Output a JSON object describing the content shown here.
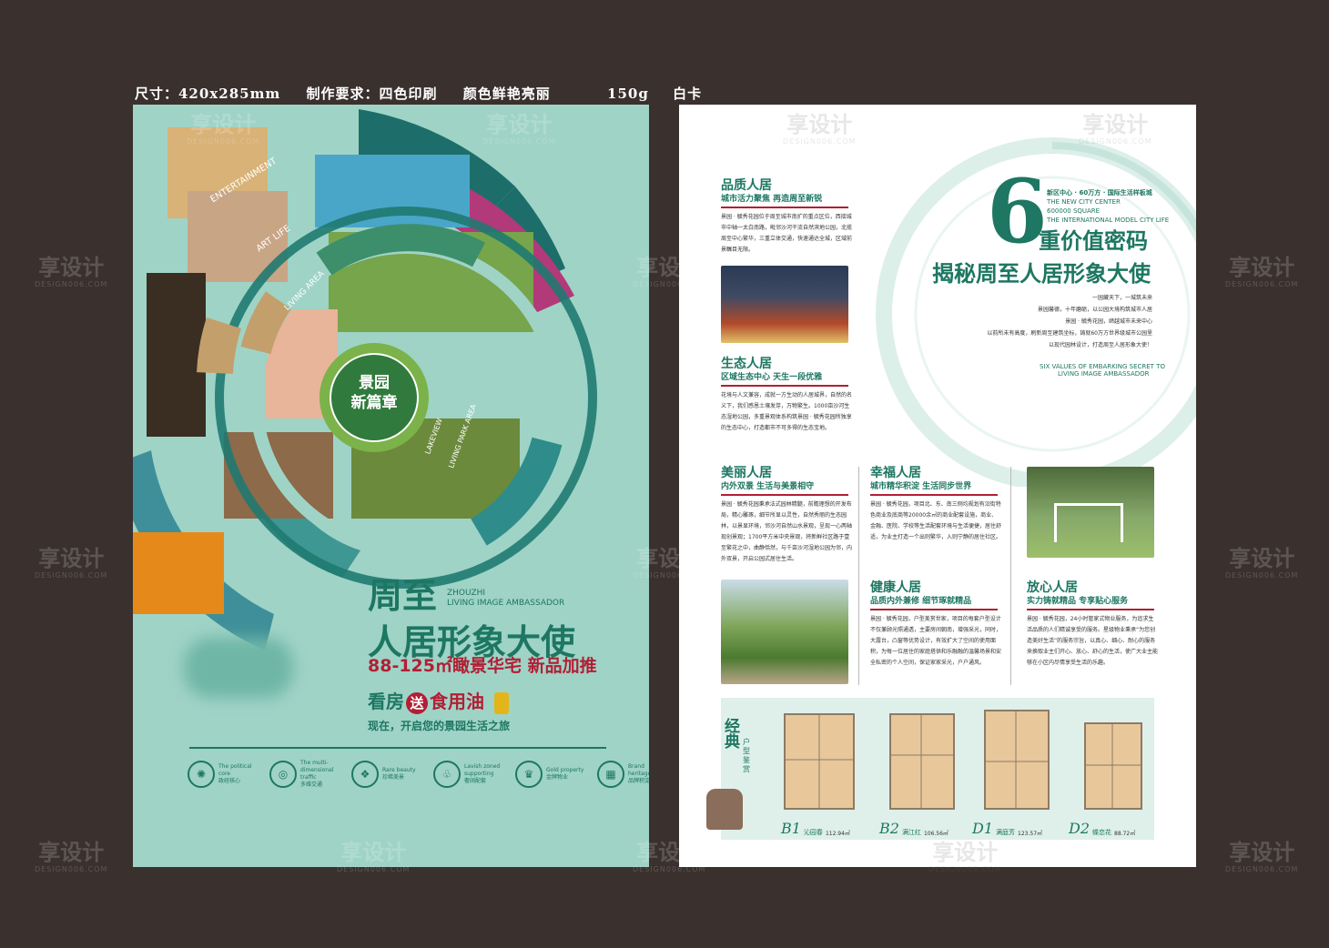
{
  "spec": {
    "size": "尺寸：420x285mm",
    "req": "制作要求：四色印刷",
    "color": "颜色鲜艳亮丽",
    "paper": "150g",
    "card": "白卡"
  },
  "watermark": {
    "cn": "享设计",
    "en": "DESIGN006.COM"
  },
  "left": {
    "badge_line1": "景园",
    "badge_line2": "新篇章",
    "ring_labels": {
      "entertainment": "ENTERTAINMENT",
      "art_life": "ART LIFE",
      "living_area": "LIVING AREA",
      "lakeview": "LAKEVIEW",
      "living_park": "LIVING PARK AREA"
    },
    "title1": "周至",
    "title_en1": "ZHOUZHI",
    "title_en2": "LIVING IMAGE AMBASSADOR",
    "title2": "人居形象大使",
    "price": "88-125㎡瞰景华宅   新品加推",
    "gift_pre": "看房",
    "gift_song": "送",
    "gift_oil": "食用油",
    "subline": "现在，开启您的景园生活之旅",
    "icons": [
      {
        "glyph": "✺",
        "cap_en": "The political core",
        "cap_cn": "政经核心"
      },
      {
        "glyph": "◎",
        "cap_en": "The multi-dimensional traffic",
        "cap_cn": "多维交通"
      },
      {
        "glyph": "❖",
        "cap_en": "Rare beauty",
        "cap_cn": "珍稀美景"
      },
      {
        "glyph": "♧",
        "cap_en": "Lavish zoned supporting",
        "cap_cn": "奢阔配套"
      },
      {
        "glyph": "♛",
        "cap_en": "Gold property",
        "cap_cn": "金牌物业"
      },
      {
        "glyph": "▦",
        "cap_en": "Brand heritage",
        "cap_cn": "品牌积淀"
      }
    ]
  },
  "right": {
    "big_number": "6",
    "headline1": "重价值密码",
    "headline2": "揭秘周至人居形象大使",
    "tag_cn": "新区中心 · 60万方 · 国际生活样板城",
    "tag_en1": "THE NEW CITY CENTER",
    "tag_en2": "600000 SQUARE",
    "tag_en3": "THE INTERNATIONAL MODEL CITY LIFE",
    "intro": [
      "一园藏天下，一城筑未来",
      "景园馨德，十年磨砺，以公园大境构筑城市人居",
      "景园 · 毓秀花园，缔越城市未来中心",
      "以前所未有高度，刷新周至建筑坐标，铸就60万方世界级城市公园里",
      "以现代园林设计，打造周至人居形象大使！"
    ],
    "intro_en1": "SIX VALUES OF EMBARKING SECRET TO",
    "intro_en2": "LIVING IMAGE AMBASSADOR",
    "sections": [
      {
        "h": "品质人居",
        "s": "城市活力聚焦 再造周至新锐",
        "b": "景园 · 毓秀花园位于周至城市南扩的重点区位，西接城市中轴一太白南路，毗邻沙河干流自然滨地公园，北揽周至中心繁华，三重立体交通，快速通达全城，区域前景瞩目无限。"
      },
      {
        "h": "生态人居",
        "s": "区域生态中心 天生一段优雅",
        "b": "花境与人文兼容，成就一方生动的人居城界，自然的名义下，我们感恩土壤发芽，万物繁生。1000亩沙河生态湿地公园，多重景观体系构筑景园 · 毓秀花园所独享的生态中心，打造都市不可多得的生态宝地。"
      },
      {
        "h": "美丽人居",
        "s": "内外双景 生活与美景相守",
        "b": "景园 · 毓秀花园秉承法式园林精髓，前瞻理想的开发布局，精心雕琢，细节所显以灵性，自然秀丽的生态园林，以景显环境，邻沙河自然山水景观，呈现一心两轴现创景观；1700平方米中央景观，将新鲜社区路于壹至繁花之中，曲静恬然，与千亩沙河湿地公园为邻，内外双景，开启公园式居住生活。"
      },
      {
        "h": "幸福人居",
        "s": "城市精华积淀 生活同步世界",
        "b": "景园 · 毓秀花园，项目北、东、南三侧均规划有沿街特色商业及底商等20000余㎡的商业配套设施，商业、金融、医院、学校等生活配套环境与生活便捷，居住舒适，为业主打造一个出则繁华，入则宁静的居住社区。"
      },
      {
        "h": "健康人居",
        "s": "品质内外兼修 细节琢就精品",
        "b": "景园 · 毓秀花园，户型美赏世家，项目的每套户型设计不仅兼顾光照通透，主要房间朝南，增强采光，同时，大露台，凸窗等优势设计，有效扩大了空间的使用面积，为每一位居住的家庭搭供和乐融融的温馨场景和安全私密的个人空间，保证家家采光，户户通风。"
      },
      {
        "h": "放心人居",
        "s": "实力铸就精品 专享贴心服务",
        "b": "景园 · 毓秀花园，24小时管家式物业服务，为追求生活品质的人们精诚享受的服务。星级物业秉承“为您创造美好生活”的服务宗旨，以真心、细心、耐心的服务来换取业主们开心、放心、舒心的生活，使广大业主能够在小区内尽情享受生活的乐趣。"
      }
    ],
    "floorplan_title": "经典",
    "floorplan_sub": "户型鉴赏",
    "plans": [
      {
        "code": "B1",
        "name": "沁园春",
        "area": "112.94㎡"
      },
      {
        "code": "B2",
        "name": "满江红",
        "area": "106.56㎡"
      },
      {
        "code": "D1",
        "name": "满庭芳",
        "area": "123.57㎡"
      },
      {
        "code": "D2",
        "name": "蝶恋花",
        "area": "88.72㎡"
      }
    ]
  }
}
